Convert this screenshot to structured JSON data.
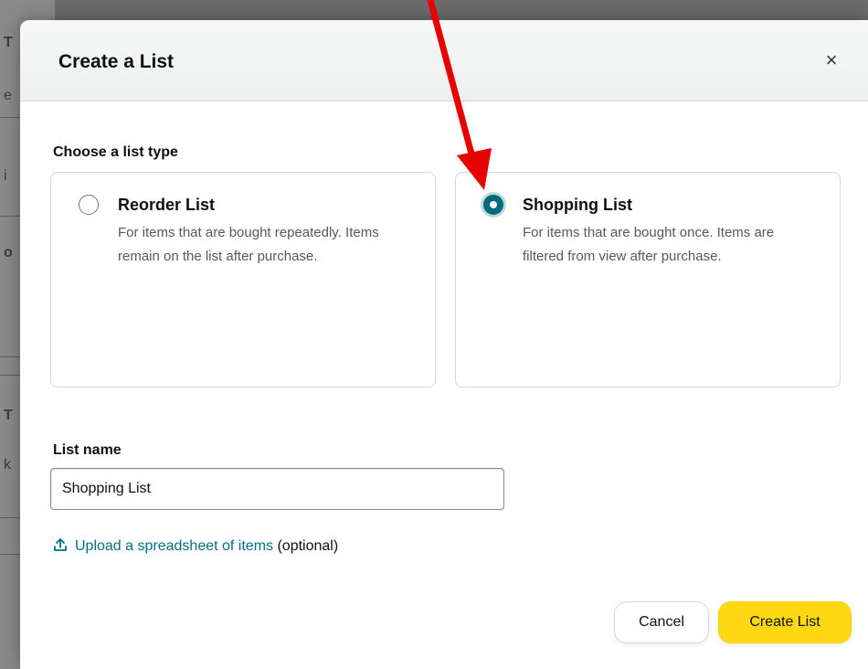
{
  "background": {
    "fragments": [
      "T",
      "e",
      "i",
      "o",
      "T",
      "k"
    ]
  },
  "modal": {
    "title": "Create a List",
    "close_icon": "close-icon",
    "close_glyph": "×"
  },
  "list_type": {
    "label": "Choose a list type",
    "selected": "Shopping List",
    "options": [
      {
        "title": "Reorder List",
        "description": "For items that are bought repeatedly. Items remain on the list after purchase.",
        "checked": false
      },
      {
        "title": "Shopping List",
        "description": "For items that are bought once. Items are filtered from view after purchase.",
        "checked": true
      }
    ]
  },
  "list_name": {
    "label": "List name",
    "value": "Shopping List"
  },
  "upload": {
    "icon": "upload-icon",
    "link_text": "Upload a spreadsheet of items",
    "suffix": "(optional)"
  },
  "actions": {
    "cancel_label": "Cancel",
    "create_label": "Create List"
  },
  "colors": {
    "accent": "#016a7b",
    "link": "#007185",
    "primary_button": "#ffd814",
    "annotation_arrow": "#e60000"
  }
}
